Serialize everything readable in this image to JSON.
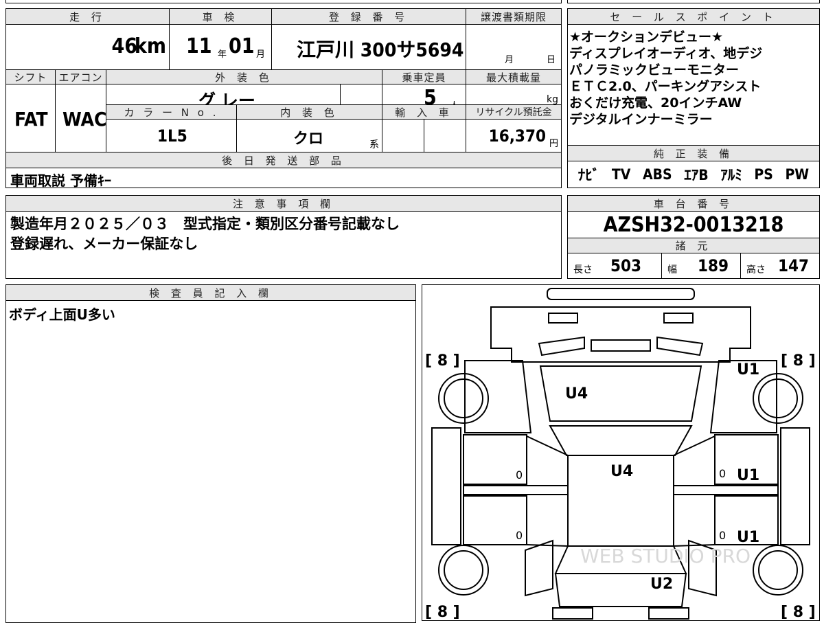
{
  "top_header": {
    "mileage_label": "走 行",
    "inspection_label": "車 検",
    "registration_label": "登 録 番 号",
    "transfer_label": "譲渡書類期限",
    "sales_label": "セ ー ル ス ポ イ ン ト"
  },
  "mileage": {
    "value": "46",
    "unit": "km"
  },
  "inspection": {
    "year": "11",
    "year_unit": "年",
    "month": "01",
    "month_unit": "月"
  },
  "registration": {
    "value": "江戸川 300サ5694"
  },
  "transfer": {
    "month_unit": "月",
    "day_unit": "日"
  },
  "row2_header": {
    "shift_label": "シフト",
    "ac_label": "エアコン",
    "exterior_label": "外 装 色",
    "capacity_label": "乗車定員",
    "max_load_label": "最大積載量"
  },
  "shift": "FAT",
  "ac": "WAC",
  "exterior_color": "グ レー",
  "capacity": {
    "value": "5",
    "unit": "人"
  },
  "max_load": {
    "unit": "kg"
  },
  "row3_header": {
    "color_no_label": "カ ラ ー N o .",
    "interior_label": "内 装 色",
    "import_label": "輸 入 車",
    "recycle_label": "リサイクル預託金"
  },
  "color_no": "1L5",
  "interior": {
    "value": "クロ",
    "suffix": "系"
  },
  "recycle": {
    "value": "16,370",
    "unit": "円"
  },
  "later_parts": {
    "label": "後 日 発 送 部 品",
    "value": "車両取説 予備ｷｰ"
  },
  "sales_points": [
    "★オークションデビュー★",
    "ディスプレイオーディオ、地デジ",
    "パノラミックビューモニター",
    "ＥＴＣ2.0、パーキングアシスト",
    "おくだけ充電、20インチAW",
    "デジタルインナーミラー"
  ],
  "genuine_equipment": {
    "label": "純 正 装 備",
    "items": [
      "ﾅﾋﾞ",
      "TV",
      "ABS",
      "ｴｱB",
      "ｱﾙﾐ",
      "PS",
      "PW"
    ]
  },
  "notes": {
    "label": "注 意 事 項 欄",
    "lines": [
      "製造年月２０２５／０３　型式指定・類別区分番号記載なし",
      "登録遅れ、メーカー保証なし"
    ]
  },
  "chassis": {
    "label": "車 台 番 号",
    "value": "AZSH32-0013218"
  },
  "specs": {
    "label": "諸 元",
    "length_label": "長さ",
    "length": "503",
    "width_label": "幅",
    "width": "189",
    "height_label": "高さ",
    "height": "147"
  },
  "inspector": {
    "label": "検 査 員 記 入 欄",
    "comment": "ボディ上面U多い"
  },
  "diagram": {
    "tire_labels": [
      "[ 8 ]",
      "[ 8 ]",
      "[ 8 ]",
      "[ 8 ]"
    ],
    "marks": {
      "hood": "U4",
      "roof": "U4",
      "front_right_fender": "U1",
      "right_front_door": "U1",
      "right_rear_door": "U1",
      "trunk": "U2",
      "left_front_door_zero": "0",
      "left_rear_door_zero": "0",
      "right_front_door_zero": "0",
      "right_rear_door_zero": "0"
    },
    "watermark": "WEB STUDIO PRO"
  }
}
